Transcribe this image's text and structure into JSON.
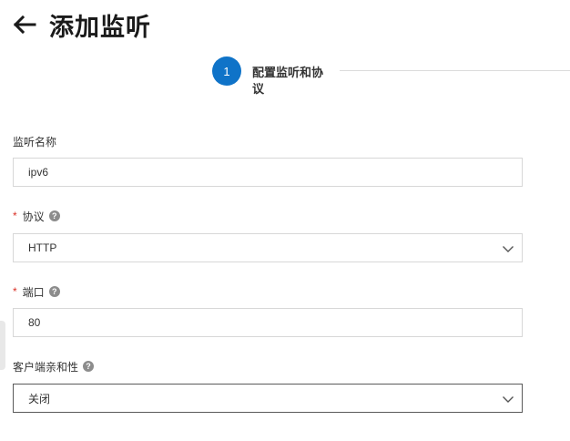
{
  "header": {
    "title": "添加监听"
  },
  "stepper": {
    "step_number": "1",
    "step_label": "配置监听和协议"
  },
  "form": {
    "listener_name": {
      "label": "监听名称",
      "value": "ipv6"
    },
    "protocol": {
      "required_mark": "*",
      "label": "协议",
      "help": "?",
      "value": "HTTP"
    },
    "port": {
      "required_mark": "*",
      "label": "端口",
      "help": "?",
      "value": "80"
    },
    "client_affinity": {
      "label": "客户端亲和性",
      "help": "?",
      "value": "关闭"
    }
  },
  "colors": {
    "accent": "#0f73c8",
    "required": "#d93026"
  },
  "icons": {
    "back": "arrow-left-icon",
    "dropdown": "chevron-down-icon",
    "help": "question-circle-icon"
  }
}
